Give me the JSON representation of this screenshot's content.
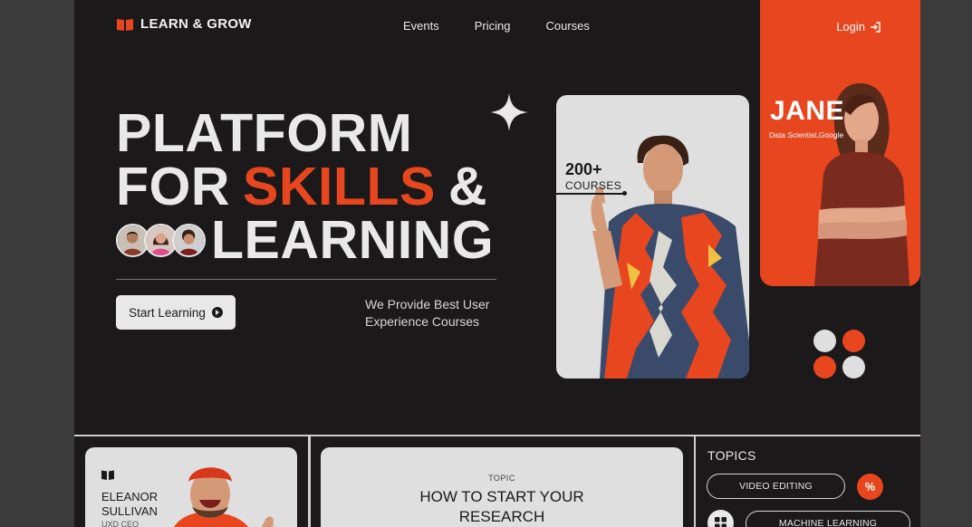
{
  "brand": {
    "name": "LEARN & GROW",
    "accent": "#e8461f"
  },
  "nav": {
    "items": [
      "Events",
      "Pricing",
      "Courses"
    ],
    "login": "Login"
  },
  "hero": {
    "line1": "PLATFORM",
    "line2_pre": "FOR",
    "line2_accent": "SKILLS",
    "line2_post": "&",
    "line3": "LEARNING",
    "cta": "Start Learning",
    "tagline": "We Provide Best User Experience Courses"
  },
  "instructor": {
    "name": "JANE",
    "role": "Data Scientist,Google"
  },
  "courses_badge": {
    "count": "200+",
    "label": "COURSES"
  },
  "bottom": {
    "mentor": {
      "name_line1": "ELEANOR",
      "name_line2": "SULLIVAN",
      "role": "UXD CEO"
    },
    "topic_card": {
      "label": "TOPIC",
      "title_line1": "HOW TO START YOUR",
      "title_line2": "RESEARCH"
    },
    "topics": {
      "heading": "TOPICS",
      "items": [
        "VIDEO EDITING",
        "MACHINE LEARNING"
      ]
    }
  },
  "icons": [
    "book-icon",
    "login-icon",
    "sparkle-icon",
    "play-icon",
    "percent-icon",
    "grid-icon"
  ]
}
